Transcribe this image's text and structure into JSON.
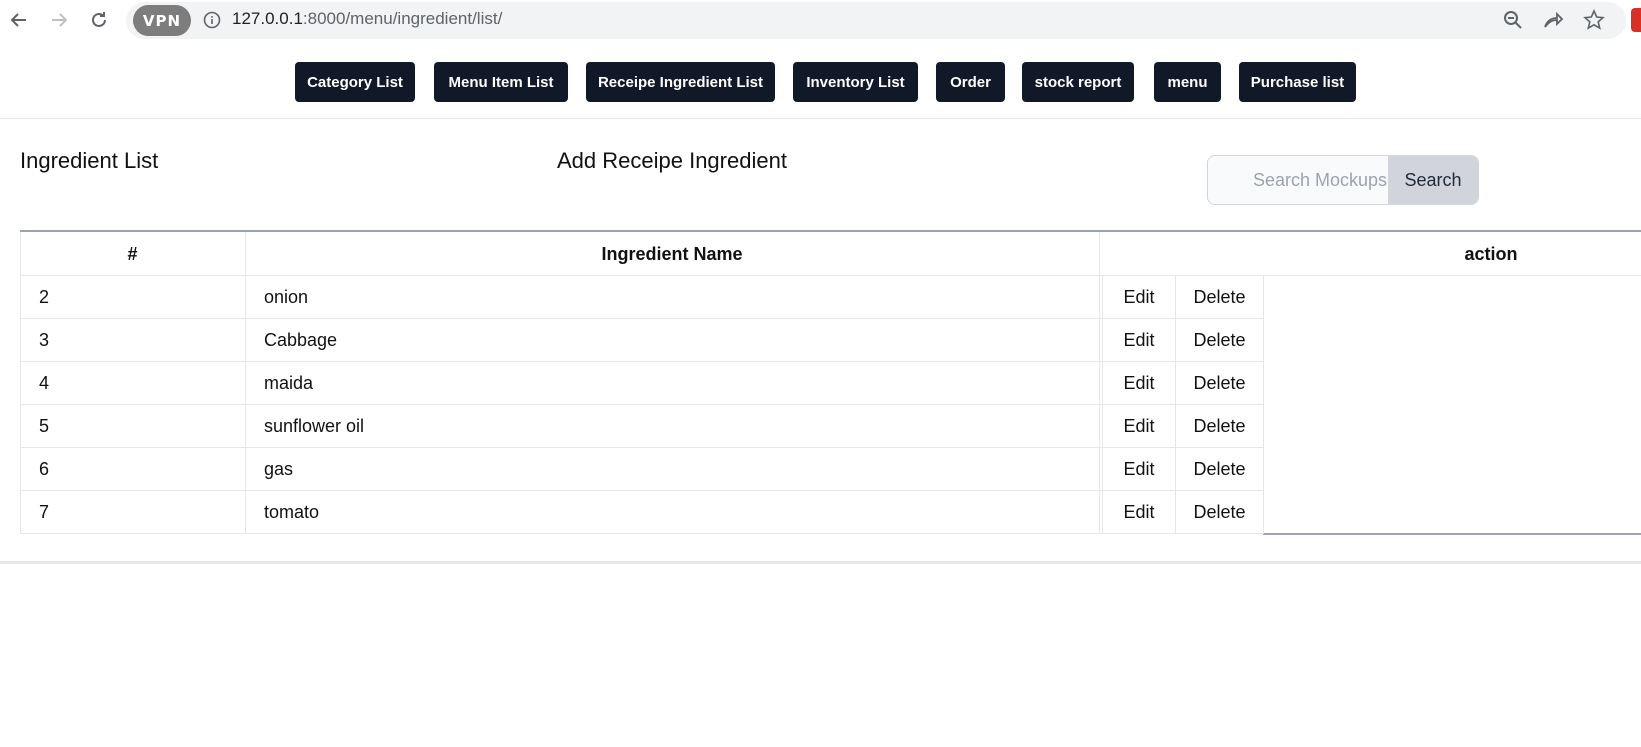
{
  "browser": {
    "vpn_label": "VPN",
    "url_host": "127.0.0.1",
    "url_path": ":8000/menu/ingredient/list/"
  },
  "topnav": {
    "items": [
      {
        "label": "Category List"
      },
      {
        "label": "Menu Item List"
      },
      {
        "label": "Receipe Ingredient List"
      },
      {
        "label": "Inventory List"
      },
      {
        "label": "Order"
      },
      {
        "label": "stock report"
      },
      {
        "label": "menu"
      },
      {
        "label": "Purchase list"
      }
    ]
  },
  "page": {
    "title": "Ingredient List",
    "add_link": "Add Receipe Ingredient"
  },
  "search": {
    "placeholder": "Search Mockups, Logos...",
    "button_label": "Search"
  },
  "table": {
    "headers": [
      "#",
      "Ingredient Name",
      "action"
    ],
    "edit_label": "Edit",
    "delete_label": "Delete",
    "rows": [
      {
        "id": "2",
        "name": "onion"
      },
      {
        "id": "3",
        "name": "Cabbage"
      },
      {
        "id": "4",
        "name": "maida"
      },
      {
        "id": "5",
        "name": "sunflower oil"
      },
      {
        "id": "6",
        "name": "gas"
      },
      {
        "id": "7",
        "name": "tomato"
      }
    ]
  },
  "colors": {
    "nav_button_bg": "#111827",
    "search_button_bg": "#d1d5db"
  }
}
